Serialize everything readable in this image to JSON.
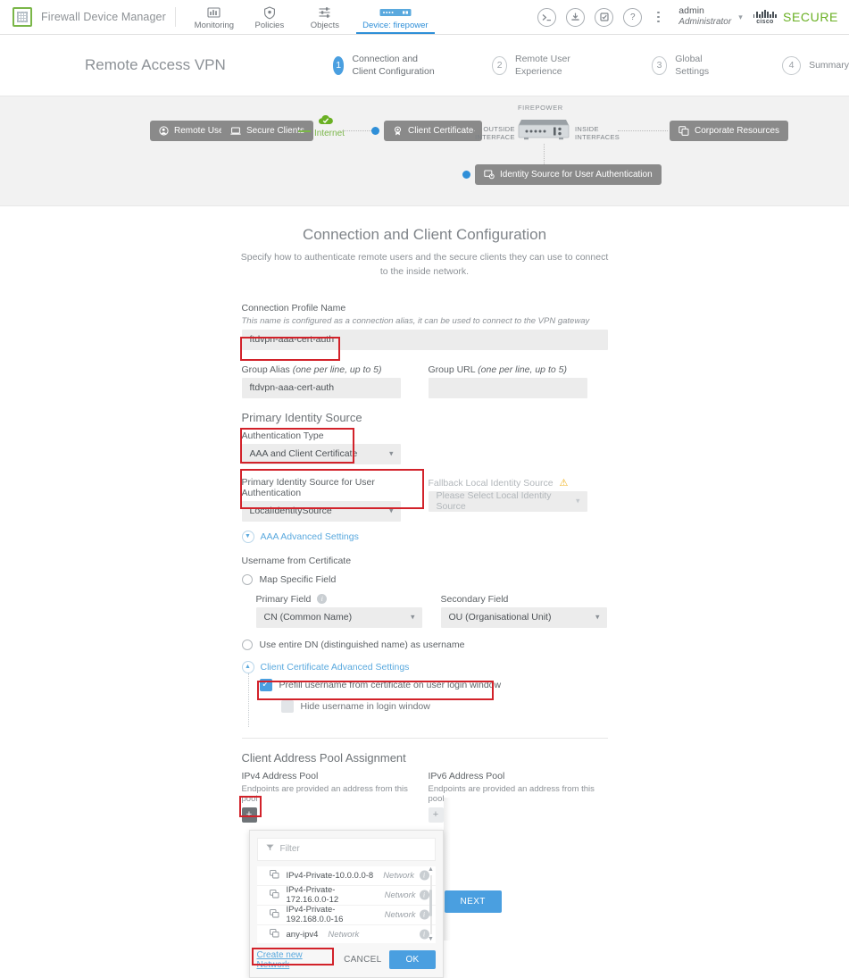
{
  "header": {
    "product_name": "Firewall Device Manager",
    "nav": [
      {
        "label": "Monitoring",
        "icon": "monitoring-icon",
        "active": false
      },
      {
        "label": "Policies",
        "icon": "policies-shield-icon",
        "active": false
      },
      {
        "label": "Objects",
        "icon": "objects-sliders-icon",
        "active": false
      },
      {
        "label": "Device: firepower",
        "icon": "device-appliance-icon",
        "active": true
      }
    ],
    "icons": [
      {
        "name": "cli-console-icon",
        "glyph": ">_"
      },
      {
        "name": "deploy-icon",
        "glyph": "↓"
      },
      {
        "name": "tasks-icon",
        "glyph": "☑"
      },
      {
        "name": "help-icon",
        "glyph": "?"
      }
    ],
    "more_menu": "more-options-icon",
    "user": {
      "name": "admin",
      "role": "Administrator"
    },
    "brand": {
      "cisco": "cisco",
      "secure": "SECURE"
    }
  },
  "page": {
    "title": "Remote Access VPN",
    "steps": [
      {
        "num": "1",
        "label": "Connection and Client Configuration",
        "active": true
      },
      {
        "num": "2",
        "label": "Remote User Experience",
        "active": false
      },
      {
        "num": "3",
        "label": "Global Settings",
        "active": false
      },
      {
        "num": "4",
        "label": "Summary",
        "active": false
      }
    ]
  },
  "diagram": {
    "nodes": [
      {
        "id": "remote-users",
        "label": "Remote Users"
      },
      {
        "id": "secure-clients",
        "label": "Secure Clients"
      },
      {
        "id": "client-certificate",
        "label": "Client Certificate"
      },
      {
        "id": "corporate-resources",
        "label": "Corporate Resources"
      },
      {
        "id": "identity-source",
        "label": "Identity Source for User Authentication"
      }
    ],
    "internet_label": "Internet",
    "firepower_label": "FIREPOWER",
    "outside_interface": "OUTSIDE\nINTERFACE",
    "outside_interface_l1": "OUTSIDE",
    "outside_interface_l2": "INTERFACE",
    "inside_interfaces_l1": "INSIDE",
    "inside_interfaces_l2": "INTERFACES"
  },
  "form": {
    "title": "Connection and Client Configuration",
    "subtitle": "Specify how to authenticate remote users and the secure clients they can use to connect to the inside network.",
    "connection_profile": {
      "label": "Connection Profile Name",
      "hint": "This name is configured as a connection alias, it can be used to connect to the VPN gateway",
      "value": "ftdvpn-aaa-cert-auth"
    },
    "group_alias": {
      "label": "Group Alias",
      "label_italic": "(one per line, up to 5)",
      "value": "ftdvpn-aaa-cert-auth"
    },
    "group_url": {
      "label": "Group URL",
      "label_italic": "(one per line, up to 5)",
      "value": ""
    },
    "primary_identity_source_title": "Primary Identity Source",
    "authentication_type": {
      "label": "Authentication Type",
      "value": "AAA and Client Certificate"
    },
    "primary_identity_source": {
      "label": "Primary Identity Source for User Authentication",
      "value": "LocalIdentitySource"
    },
    "fallback_local_identity_source": {
      "label": "Fallback Local Identity Source",
      "placeholder": "Please Select Local Identity Source",
      "value": ""
    },
    "aaa_advanced_settings": "AAA Advanced Settings",
    "username_from_certificate": {
      "label": "Username from Certificate",
      "option_map_specific": "Map Specific Field",
      "option_entire_dn": "Use entire DN (distinguished name) as username",
      "primary_field_label": "Primary Field",
      "primary_field_value": "CN (Common Name)",
      "secondary_field_label": "Secondary Field",
      "secondary_field_value": "OU (Organisational Unit)"
    },
    "client_cert_advanced": {
      "title": "Client Certificate Advanced Settings",
      "prefill_label": "Prefill username from certificate on user login window",
      "prefill_checked": true,
      "hide_label": "Hide username in login window",
      "hide_checked": false
    },
    "address_pool_title": "Client Address Pool Assignment",
    "ipv4_pool": {
      "label": "IPv4 Address Pool",
      "hint": "Endpoints are provided an address from this pool",
      "add_button": "+"
    },
    "ipv6_pool": {
      "label": "IPv6 Address Pool",
      "hint": "Endpoints are provided an address from this pool",
      "add_button": "+"
    },
    "next_button": "NEXT"
  },
  "dropdown": {
    "filter_placeholder": "Filter",
    "items": [
      {
        "name": "IPv4-Private-10.0.0.0-8",
        "type": "Network"
      },
      {
        "name": "IPv4-Private-172.16.0.0-12",
        "type": "Network"
      },
      {
        "name": "IPv4-Private-192.168.0.0-16",
        "type": "Network"
      },
      {
        "name": "any-ipv4",
        "type": "Network"
      }
    ],
    "create_link": "Create new Network",
    "cancel_button": "CANCEL",
    "ok_button": "OK"
  },
  "colors": {
    "accent_blue": "#4a9fe0",
    "link_blue": "#5aa9de",
    "highlight_red": "#d2222a",
    "green": "#7ab648",
    "node_gray": "#8a8a8a"
  }
}
